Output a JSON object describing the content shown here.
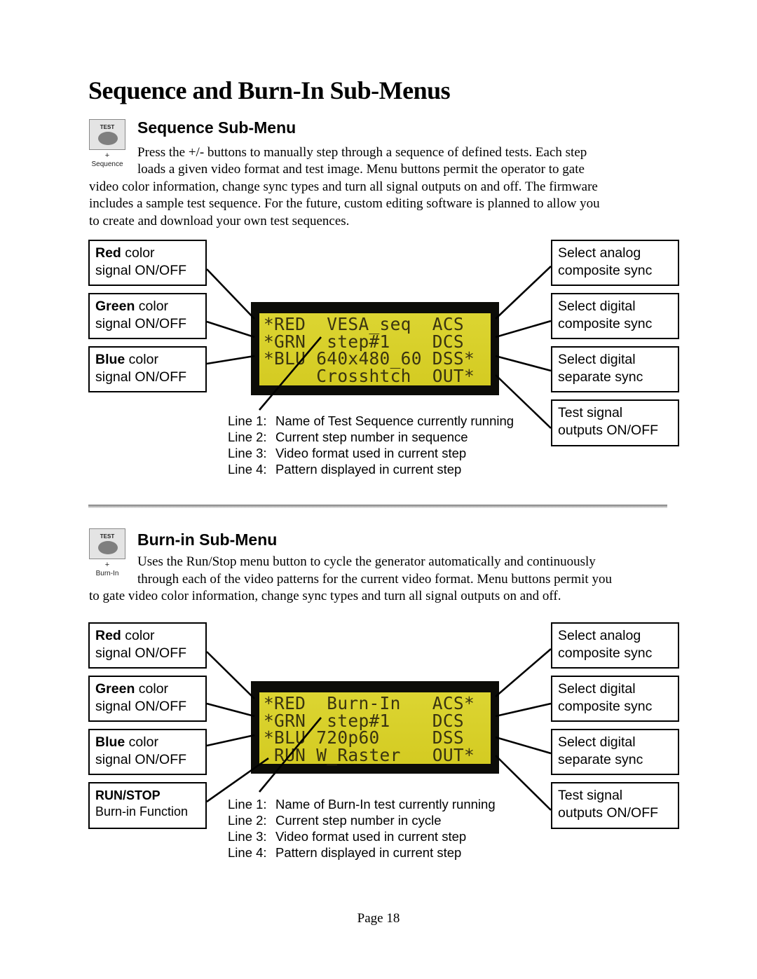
{
  "page_title": "Sequence and Burn-In Sub-Menus",
  "sequence": {
    "title": "Sequence Sub-Menu",
    "icon": {
      "button_label": "TEST",
      "plus": "+",
      "caption": "Sequence"
    },
    "paragraph_lines": [
      "Press the +/- buttons to manually step through a sequence of defined tests. Each step",
      "loads a given video format and test image. Menu buttons permit the operator to gate",
      "video color information, change sync types and turn all signal outputs on and off. The firmware",
      "includes a sample test sequence. For the future, custom editing software is planned to allow you",
      "to create and download your own test sequences."
    ],
    "left_boxes": [
      {
        "bold": "Red",
        "rest": " color",
        "line2": "signal ON/OFF"
      },
      {
        "bold": "Green",
        "rest": " color",
        "line2": "signal ON/OFF"
      },
      {
        "bold": "Blue",
        "rest": " color",
        "line2": "signal ON/OFF"
      }
    ],
    "right_boxes": [
      {
        "line1": "Select analog",
        "line2": "composite sync"
      },
      {
        "line1": "Select digital",
        "line2": "composite sync"
      },
      {
        "line1": "Select digital",
        "line2": "separate sync"
      },
      {
        "line1": "Test signal",
        "line2": "outputs ON/OFF"
      }
    ],
    "lcd_lines": [
      "*RED  VESA_seq  ACS ",
      "*GRN  step#1    DCS ",
      "*BLU 640x480_60 DSS*",
      "     Crosshtch  OUT*"
    ],
    "legend": [
      {
        "key": "Line 1:",
        "text": "Name of Test Sequence currently running"
      },
      {
        "key": "Line 2:",
        "text": "Current step number in sequence"
      },
      {
        "key": "Line 3:",
        "text": "Video format used in current step"
      },
      {
        "key": "Line 4:",
        "text": "Pattern displayed in current step"
      }
    ]
  },
  "burnin": {
    "title": "Burn-in Sub-Menu",
    "icon": {
      "button_label": "TEST",
      "plus": "+",
      "caption": "Burn-In"
    },
    "paragraph_lines": [
      "Uses the Run/Stop menu button to cycle the generator automatically and continuously",
      "through each of the video patterns for the current video format. Menu buttons permit you",
      "to gate video color information, change sync types and turn all signal outputs on and off."
    ],
    "left_boxes": [
      {
        "bold": "Red",
        "rest": " color",
        "line2": "signal ON/OFF"
      },
      {
        "bold": "Green",
        "rest": " color",
        "line2": "signal ON/OFF"
      },
      {
        "bold": "Blue",
        "rest": " color",
        "line2": "signal ON/OFF"
      },
      {
        "bold": "RUN/STOP",
        "rest": "",
        "line2": "Burn-in Function"
      }
    ],
    "right_boxes": [
      {
        "line1": "Select analog",
        "line2": "composite sync"
      },
      {
        "line1": "Select digital",
        "line2": "composite sync"
      },
      {
        "line1": "Select digital",
        "line2": "separate sync"
      },
      {
        "line1": "Test signal",
        "line2": "outputs ON/OFF"
      }
    ],
    "lcd_lines": [
      "*RED  Burn-In   ACS*",
      "*GRN  step#1    DCS ",
      "*BLU 720p60     DSS ",
      " RUN W_Raster   OUT*"
    ],
    "legend": [
      {
        "key": "Line 1:",
        "text": "Name of Burn-In test currently running"
      },
      {
        "key": "Line 2:",
        "text": "Current step number in cycle"
      },
      {
        "key": "Line 3:",
        "text": "Video format used in current step"
      },
      {
        "key": "Line 4:",
        "text": "Pattern displayed in current step"
      }
    ]
  },
  "footer": {
    "page_label": "Page 18"
  }
}
